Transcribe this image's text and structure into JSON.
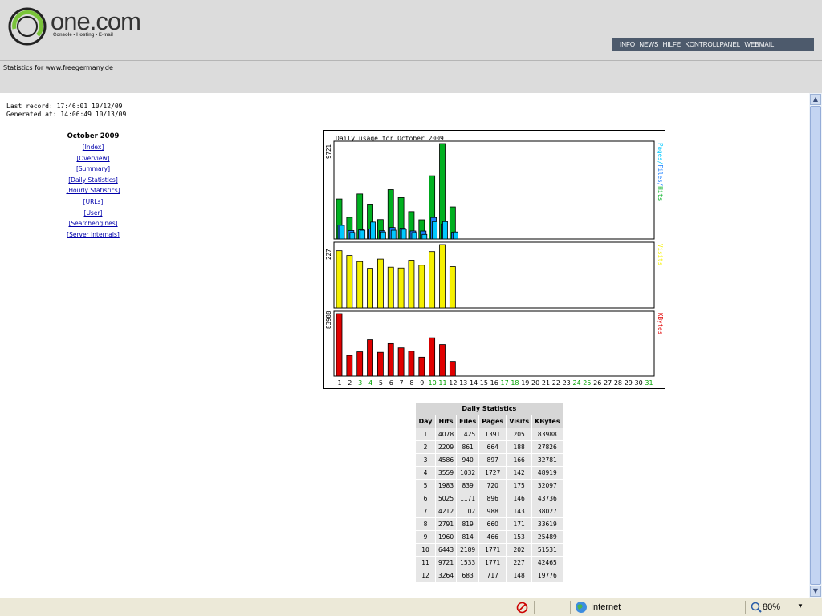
{
  "header": {
    "logo_text": "one.com",
    "logo_tagline": "Console • Hosting • E-mail",
    "nav": [
      "INFO",
      "NEWS",
      "HILFE",
      "KONTROLLPANEL",
      "WEBMAIL"
    ]
  },
  "subheader": {
    "title": "Statistics for www.freegermany.de"
  },
  "records": {
    "last_record": "Last record: 17:46:01 10/12/09",
    "generated": "Generated at: 14:06:49 10/13/09"
  },
  "menu": {
    "title": "October 2009",
    "items": [
      "[Index]",
      "[Overview]",
      "[Summary]",
      "[Daily Statistics]",
      "[Hourly Statistics]",
      "[URLs]",
      "[User]",
      "[Searchengines]",
      "[Server Internals]"
    ]
  },
  "chart_data": {
    "type": "bar",
    "title": "Daily usage for October 2009",
    "categories": [
      "1",
      "2",
      "3",
      "4",
      "5",
      "6",
      "7",
      "8",
      "9",
      "10",
      "11",
      "12",
      "13",
      "14",
      "15",
      "16",
      "17",
      "18",
      "19",
      "20",
      "21",
      "22",
      "23",
      "24",
      "25",
      "26",
      "27",
      "28",
      "29",
      "30",
      "31"
    ],
    "weekend_days": [
      "3",
      "4",
      "10",
      "11",
      "17",
      "18",
      "24",
      "25",
      "31"
    ],
    "panels": [
      {
        "ylabel_right": "Pages/Files/Hits",
        "ymax_label": "9721",
        "ymax": 9721,
        "series": [
          {
            "name": "Hits",
            "color": "#00b020",
            "values": [
              4078,
              2209,
              4586,
              3559,
              1983,
              5025,
              4212,
              2791,
              1960,
              6443,
              9721,
              3264
            ]
          },
          {
            "name": "Files",
            "color": "#1a7fff",
            "values": [
              1425,
              861,
              940,
              1032,
              839,
              1171,
              1102,
              819,
              814,
              2189,
              1533,
              683
            ]
          },
          {
            "name": "Pages",
            "color": "#00c8ff",
            "values": [
              1391,
              664,
              897,
              1727,
              720,
              896,
              988,
              660,
              466,
              1771,
              1771,
              717
            ]
          }
        ]
      },
      {
        "ylabel_right": "Visits",
        "ymax_label": "227",
        "ymax": 227,
        "series": [
          {
            "name": "Visits",
            "color": "#f5f000",
            "values": [
              205,
              188,
              166,
              142,
              175,
              146,
              143,
              171,
              153,
              202,
              227,
              148
            ]
          }
        ]
      },
      {
        "ylabel_right": "KBytes",
        "ymax_label": "83988",
        "ymax": 83988,
        "series": [
          {
            "name": "KBytes",
            "color": "#e00000",
            "values": [
              83988,
              27826,
              32781,
              48919,
              32097,
              43736,
              38027,
              33619,
              25489,
              51531,
              42465,
              19776
            ]
          }
        ]
      }
    ]
  },
  "table": {
    "title": "Daily Statistics",
    "headers": [
      "Day",
      "Hits",
      "Files",
      "Pages",
      "Visits",
      "KBytes"
    ],
    "rows": [
      [
        "1",
        "4078",
        "1425",
        "1391",
        "205",
        "83988"
      ],
      [
        "2",
        "2209",
        "861",
        "664",
        "188",
        "27826"
      ],
      [
        "3",
        "4586",
        "940",
        "897",
        "166",
        "32781"
      ],
      [
        "4",
        "3559",
        "1032",
        "1727",
        "142",
        "48919"
      ],
      [
        "5",
        "1983",
        "839",
        "720",
        "175",
        "32097"
      ],
      [
        "6",
        "5025",
        "1171",
        "896",
        "146",
        "43736"
      ],
      [
        "7",
        "4212",
        "1102",
        "988",
        "143",
        "38027"
      ],
      [
        "8",
        "2791",
        "819",
        "660",
        "171",
        "33619"
      ],
      [
        "9",
        "1960",
        "814",
        "466",
        "153",
        "25489"
      ],
      [
        "10",
        "6443",
        "2189",
        "1771",
        "202",
        "51531"
      ],
      [
        "11",
        "9721",
        "1533",
        "1771",
        "227",
        "42465"
      ],
      [
        "12",
        "3264",
        "683",
        "717",
        "148",
        "19776"
      ]
    ]
  },
  "statusbar": {
    "zone": "Internet",
    "zoom": "80%"
  }
}
